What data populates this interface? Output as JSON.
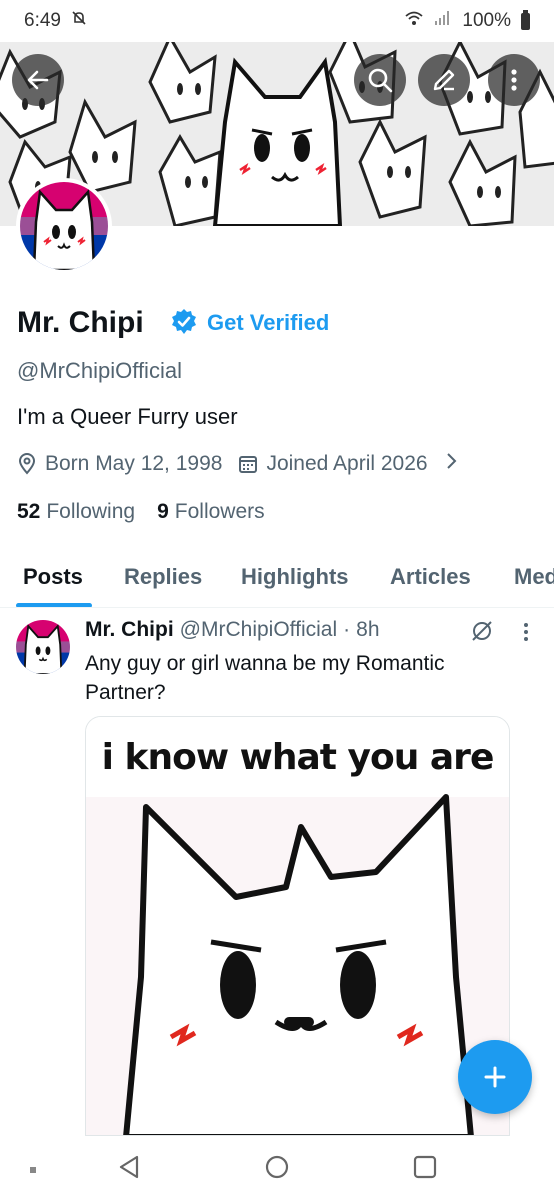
{
  "status_bar": {
    "time": "6:49",
    "battery": "100%"
  },
  "profile": {
    "display_name": "Mr. Chipi",
    "get_verified": "Get Verified",
    "handle": "@MrChipiOfficial",
    "bio": "I'm a Queer Furry user",
    "born": "Born May 12, 1998",
    "joined": "Joined April 2026",
    "following_count": "52",
    "following_label": "Following",
    "followers_count": "9",
    "followers_label": "Followers"
  },
  "tabs": [
    "Posts",
    "Replies",
    "Highlights",
    "Articles",
    "Media"
  ],
  "post": {
    "name": "Mr. Chipi",
    "handle": "@MrChipiOfficial",
    "separator": "·",
    "time": "8h",
    "text": "Any guy or girl wanna be my Romantic Partner?",
    "image_caption": "i know what you are"
  },
  "colors": {
    "accent": "#1d9bf0",
    "secondary_text": "#536471",
    "primary_text": "#0f1419"
  },
  "icons": [
    "back-arrow-icon",
    "search-icon",
    "edit-icon",
    "more-vertical-icon",
    "verified-badge-icon",
    "location-icon",
    "calendar-icon",
    "chevron-right-icon",
    "grok-icon",
    "more-icon",
    "plus-icon",
    "nav-back-icon",
    "nav-home-icon",
    "nav-recents-icon"
  ]
}
